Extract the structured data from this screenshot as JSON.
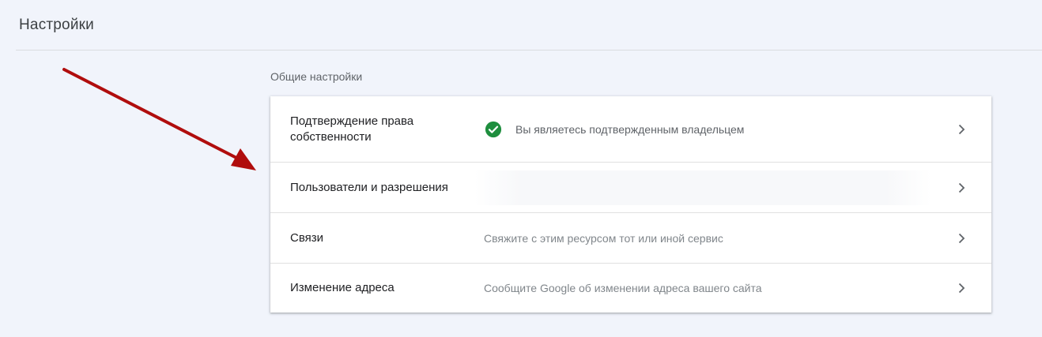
{
  "header": {
    "title": "Настройки"
  },
  "general": {
    "title": "Общие настройки",
    "rows": [
      {
        "label": "Подтверждение права собственности",
        "description": "Вы являетесь подтвержденным владельцем",
        "icon": "check-circle-icon"
      },
      {
        "label": "Пользователи и разрешения",
        "description": ""
      },
      {
        "label": "Связи",
        "description": "Свяжите с этим ресурсом тот или иной сервис"
      },
      {
        "label": "Изменение адреса",
        "description": "Сообщите Google об изменении адреса вашего сайта"
      }
    ]
  },
  "colors": {
    "accent_green": "#1e8e3e",
    "annotation_arrow": "#b00d0d"
  }
}
